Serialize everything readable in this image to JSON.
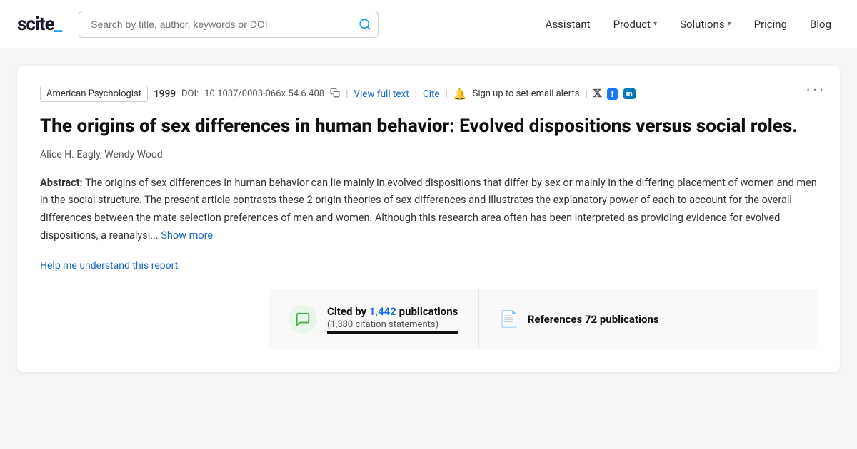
{
  "nav": {
    "logo_text": "scite_",
    "search_placeholder": "Search by title, author, keywords or DOI",
    "links": [
      {
        "label": "Assistant",
        "has_dropdown": false
      },
      {
        "label": "Product",
        "has_dropdown": true
      },
      {
        "label": "Solutions",
        "has_dropdown": true
      },
      {
        "label": "Pricing",
        "has_dropdown": false
      },
      {
        "label": "Blog",
        "has_dropdown": false
      }
    ]
  },
  "paper": {
    "journal": "American Psychologist",
    "year": "1999",
    "doi_label": "DOI:",
    "doi_value": "10.1037/0003-066x.54.6.408",
    "view_full_text": "View full text",
    "cite": "Cite",
    "email_alert": "Sign up to set email alerts",
    "more_btn": "···",
    "title": "The origins of sex differences in human behavior: Evolved dispositions versus social roles.",
    "authors": "Alice H. Eagly, Wendy Wood",
    "abstract_label": "Abstract:",
    "abstract_text": "The origins of sex differences in human behavior can lie mainly in evolved dispositions that differ by sex or mainly in the differing placement of women and men in the social structure. The present article contrasts these 2 origin theories of sex differences and illustrates the explanatory power of each to account for the overall differences between the mate selection preferences of men and women. Although this research area often has been interpreted as providing evidence for evolved dispositions, a reanalysi...",
    "show_more": "Show more",
    "help_link": "Help me understand this report"
  },
  "stats": {
    "cited_by_label": "Cited by ",
    "cited_by_count": "1,442",
    "cited_by_suffix": " publications",
    "citation_statements": "(1,380 citation statements)",
    "refs_label": "References ",
    "refs_count": "72",
    "refs_suffix": " publications"
  },
  "icons": {
    "twitter": "𝕏",
    "facebook": "f",
    "linkedin": "in"
  }
}
